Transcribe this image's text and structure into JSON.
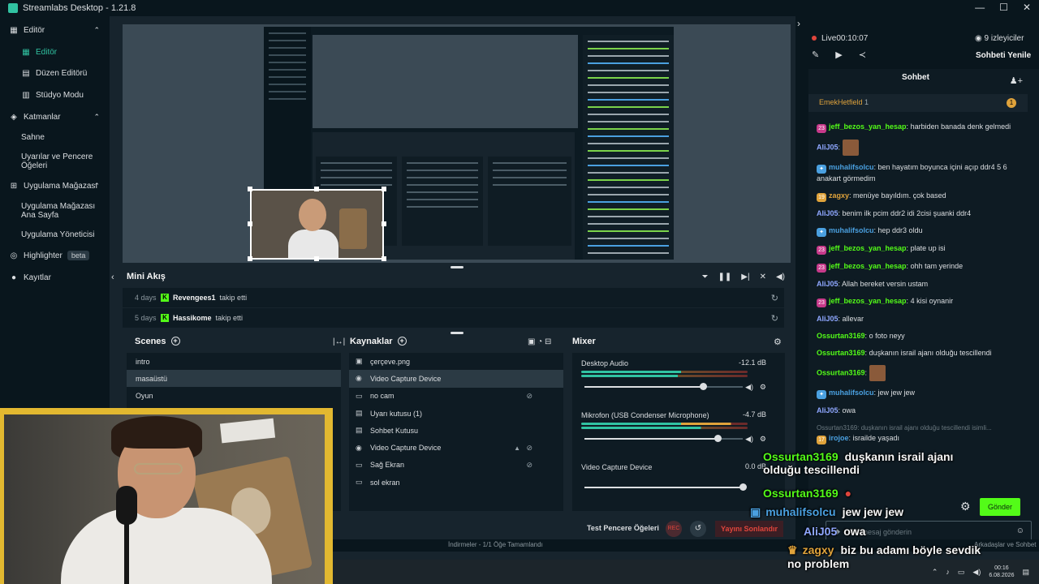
{
  "app": {
    "title": "Streamlabs Desktop - 1.21.8"
  },
  "sidebar": {
    "editor_group": "Editör",
    "items": [
      {
        "label": "Editör",
        "icon": "editor-icon"
      },
      {
        "label": "Düzen Editörü",
        "icon": "layout-icon"
      },
      {
        "label": "Stüdyo Modu",
        "icon": "studio-icon"
      }
    ],
    "layers_group": "Katmanlar",
    "layer_items": [
      "Sahne",
      "Uyarılar ve Pencere Öğeleri"
    ],
    "store_group": "Uygulama Mağazası",
    "store_items": [
      "Uygulama Mağazası Ana Sayfa",
      "Uygulama Yöneticisi"
    ],
    "highlighter": "Highlighter",
    "highlighter_badge": "beta",
    "recordings": "Kayıtlar"
  },
  "mini_feed": {
    "title": "Mini Akış",
    "events": [
      {
        "time": "4 days",
        "user": "Revengees1",
        "action": "takip etti"
      },
      {
        "time": "5 days",
        "user": "Hassikome",
        "action": "takip etti"
      }
    ]
  },
  "scenes": {
    "title": "Scenes",
    "items": [
      "intro",
      "masaüstü",
      "Oyun"
    ],
    "selected": "masaüstü"
  },
  "sources": {
    "title": "Kaynaklar",
    "items": [
      {
        "label": "çerçeve.png",
        "icon": "image-icon"
      },
      {
        "label": "Video Capture Device",
        "icon": "webcam-icon"
      },
      {
        "label": "no cam",
        "icon": "screen-icon"
      },
      {
        "label": "Uyarı kutusu (1)",
        "icon": "alert-box-icon"
      },
      {
        "label": "Sohbet Kutusu",
        "icon": "chat-box-icon"
      },
      {
        "label": "Video Capture Device",
        "icon": "webcam-icon"
      },
      {
        "label": "Sağ Ekran",
        "icon": "screen-icon"
      },
      {
        "label": "sol ekran",
        "icon": "screen-icon"
      }
    ]
  },
  "mixer": {
    "title": "Mixer",
    "channels": [
      {
        "name": "Desktop Audio",
        "db": "-12.1 dB",
        "level": 0.75
      },
      {
        "name": "Mikrofon (USB Condenser Microphone)",
        "db": "-4.7 dB",
        "level": 0.84
      },
      {
        "name": "Video Capture Device",
        "db": "0.0 dB",
        "level": 1.0
      }
    ]
  },
  "footer": {
    "test_widgets": "Test Pencere Öğeleri",
    "rec": "REC",
    "end_stream": "Yayını Sonlandır"
  },
  "statusbar": {
    "downloads": "İndirmeler - 1/1 Öğe Tamamlandı",
    "friends": "Arkadaşlar ve Sohbet"
  },
  "right": {
    "live_label": "Live",
    "live_time": "00:10:07",
    "viewers": "9 izleyiciler",
    "refresh_chat": "Sohbeti Yenile",
    "chat_title": "Sohbet",
    "pinned_user": "EmekHetfield",
    "pinned_count": "1",
    "pinned_badge": "1",
    "input_placeholder": "Bir mesaj gönderin",
    "send": "Gönder"
  },
  "chat": {
    "messages": [
      {
        "badge": "23",
        "user": "jeff_bezos_yan_hesap",
        "color": "#53fc18",
        "text": "harbiden banada denk gelmedi"
      },
      {
        "user": "AliJ05",
        "color": "#8fa7ff",
        "text": "",
        "emote": true
      },
      {
        "badge": "blue",
        "user": "muhalifsolcu",
        "color": "#4aa0e0",
        "text": "ben hayatım boyunca içini açıp ddr4 5 6 anakart görmedim"
      },
      {
        "badge": "19",
        "user": "zagxy",
        "color": "#e0a33b",
        "text": "menüye bayıldım. çok based"
      },
      {
        "user": "AliJ05",
        "color": "#8fa7ff",
        "text": "benim ilk pcim ddr2 idi 2cisi şuanki ddr4"
      },
      {
        "badge": "blue",
        "user": "muhalifsolcu",
        "color": "#4aa0e0",
        "text": "hep ddr3 oldu"
      },
      {
        "badge": "23",
        "user": "jeff_bezos_yan_hesap",
        "color": "#53fc18",
        "text": "plate up isi"
      },
      {
        "badge": "23",
        "user": "jeff_bezos_yan_hesap",
        "color": "#53fc18",
        "text": "ohh tam yerinde"
      },
      {
        "user": "AliJ05",
        "color": "#8fa7ff",
        "text": "Allah bereket versin ustam"
      },
      {
        "badge": "23",
        "user": "jeff_bezos_yan_hesap",
        "color": "#53fc18",
        "text": "4 kisi oynanir"
      },
      {
        "user": "AliJ05",
        "color": "#8fa7ff",
        "text": "allevar"
      },
      {
        "user": "Ossurtan3169",
        "color": "#53fc18",
        "text": "o foto neyy"
      },
      {
        "user": "Ossurtan3169",
        "color": "#53fc18",
        "text": "duşkanın israil ajanı olduğu tescillendi"
      },
      {
        "user": "Ossurtan3169",
        "color": "#53fc18",
        "text": "",
        "emote": true
      },
      {
        "badge": "blue",
        "user": "muhalifsolcu",
        "color": "#4aa0e0",
        "text": "jew jew jew"
      },
      {
        "user": "AliJ05",
        "color": "#8fa7ff",
        "text": "owa"
      },
      {
        "reply": "Ossurtan3169: duşkanın israil ajanı olduğu tescillendi isimli...",
        "badge": "17",
        "user": "irojoe",
        "color": "#4aa0e0",
        "text": "israilde yaşadı"
      }
    ]
  },
  "overlay": {
    "lines": [
      {
        "user": "Ossurtan3169",
        "text": "duşkanın israil ajanı olduğu tescillendi",
        "color": "#53fc18"
      },
      {
        "user": "Ossurtan3169",
        "text": "",
        "color": "#53fc18"
      },
      {
        "user": "muhalifsolcu",
        "text": "jew jew jew",
        "color": "#4aa0e0"
      },
      {
        "user": "AliJ05",
        "text": "owa",
        "color": "#8fa7ff"
      },
      {
        "user": "zagxy",
        "text": "biz bu adamı böyle sevdik no problem",
        "color": "#e0a33b"
      }
    ]
  },
  "taskbar": {
    "time": "00:16",
    "date": "6.08.2026"
  }
}
